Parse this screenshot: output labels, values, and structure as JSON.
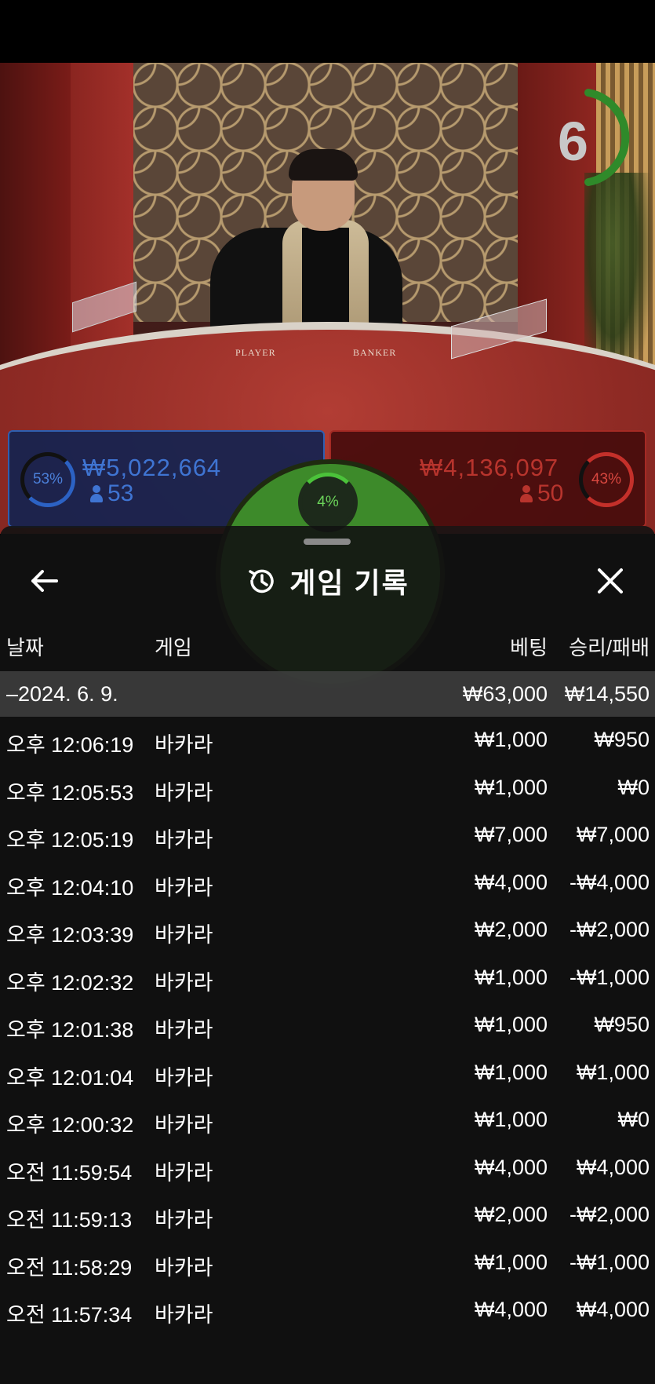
{
  "stage": {
    "timer_value": "6",
    "table_labels": [
      "PLAYER",
      "BANKER"
    ],
    "player": {
      "percent": "53%",
      "amount": "₩5,022,664",
      "count": "53"
    },
    "banker": {
      "percent": "43%",
      "amount": "₩4,136,097",
      "count": "50"
    },
    "tie": {
      "percent": "4%"
    }
  },
  "sheet": {
    "title": "게임 기록",
    "icons": {
      "back": "arrow-left-icon",
      "history": "history-clock-icon",
      "close": "close-x-icon"
    },
    "columns": {
      "date": "날짜",
      "game": "게임",
      "bet": "베팅",
      "win_loss": "승리/패배"
    },
    "date_group": {
      "label": "–2024. 6. 9.",
      "bet_total": "₩63,000",
      "win_total": "₩14,550"
    },
    "rows": [
      {
        "time": "오후 12:06:19",
        "game": "바카라",
        "bet": "₩1,000",
        "result": "₩950"
      },
      {
        "time": "오후 12:05:53",
        "game": "바카라",
        "bet": "₩1,000",
        "result": "₩0"
      },
      {
        "time": "오후 12:05:19",
        "game": "바카라",
        "bet": "₩7,000",
        "result": "₩7,000"
      },
      {
        "time": "오후 12:04:10",
        "game": "바카라",
        "bet": "₩4,000",
        "result": "-₩4,000"
      },
      {
        "time": "오후 12:03:39",
        "game": "바카라",
        "bet": "₩2,000",
        "result": "-₩2,000"
      },
      {
        "time": "오후 12:02:32",
        "game": "바카라",
        "bet": "₩1,000",
        "result": "-₩1,000"
      },
      {
        "time": "오후 12:01:38",
        "game": "바카라",
        "bet": "₩1,000",
        "result": "₩950"
      },
      {
        "time": "오후 12:01:04",
        "game": "바카라",
        "bet": "₩1,000",
        "result": "₩1,000"
      },
      {
        "time": "오후 12:00:32",
        "game": "바카라",
        "bet": "₩1,000",
        "result": "₩0"
      },
      {
        "time": "오전 11:59:54",
        "game": "바카라",
        "bet": "₩4,000",
        "result": "₩4,000"
      },
      {
        "time": "오전 11:59:13",
        "game": "바카라",
        "bet": "₩2,000",
        "result": "-₩2,000"
      },
      {
        "time": "오전 11:58:29",
        "game": "바카라",
        "bet": "₩1,000",
        "result": "-₩1,000"
      },
      {
        "time": "오전 11:57:34",
        "game": "바카라",
        "bet": "₩4,000",
        "result": "₩4,000"
      }
    ]
  }
}
